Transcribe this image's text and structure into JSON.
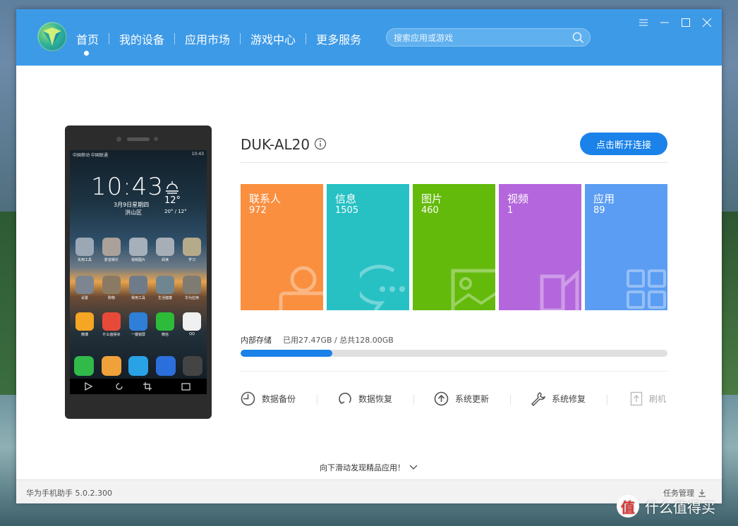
{
  "app": {
    "title": "华为手机助手",
    "version": "华为手机助手 5.0.2.300",
    "nav": [
      {
        "label": "首页",
        "active": true
      },
      {
        "label": "我的设备"
      },
      {
        "label": "应用市场"
      },
      {
        "label": "游戏中心"
      },
      {
        "label": "更多服务"
      }
    ],
    "search": {
      "placeholder": "搜索应用或游戏"
    },
    "colors": {
      "titlebar": "#3d9ae7",
      "accent": "#1a82e8"
    }
  },
  "device": {
    "name": "DUK-AL20",
    "disconnect_label": "点击断开连接",
    "phone_screen": {
      "status_left": "中国移动 中国联通",
      "status_right": "10:43",
      "time": "10:43",
      "date": "3月9日星期四",
      "location": "洪山区",
      "temperature": "12°",
      "temp_range": "20° / 12°",
      "row1": [
        "实用工具",
        "影音娱乐",
        "视频图片",
        "阅读",
        "学习"
      ],
      "row2": [
        "设置",
        "购物",
        "常用工具",
        "生活健康",
        "华为应用"
      ],
      "row3": [
        "微博",
        "什么值得买",
        "一键锁屏",
        "微信",
        "QQ"
      ]
    }
  },
  "tiles": [
    {
      "label": "联系人",
      "count": "972",
      "color": "#f98f3f",
      "icon": "person-icon"
    },
    {
      "label": "信息",
      "count": "1505",
      "color": "#27c1c4",
      "icon": "chat-icon"
    },
    {
      "label": "图片",
      "count": "460",
      "color": "#63ba0b",
      "icon": "image-icon"
    },
    {
      "label": "视频",
      "count": "1",
      "color": "#b467dc",
      "icon": "video-icon"
    },
    {
      "label": "应用",
      "count": "89",
      "color": "#5b9df2",
      "icon": "apps-icon"
    }
  ],
  "storage": {
    "label": "内部存储",
    "text": "已用27.47GB / 总共128.00GB",
    "used_fraction": 0.2146
  },
  "actions": [
    {
      "label": "数据备份",
      "icon": "backup-icon",
      "enabled": true
    },
    {
      "label": "数据恢复",
      "icon": "restore-icon",
      "enabled": true
    },
    {
      "label": "系统更新",
      "icon": "update-icon",
      "enabled": true
    },
    {
      "label": "系统修复",
      "icon": "wrench-icon",
      "enabled": true
    },
    {
      "label": "刷机",
      "icon": "flash-icon",
      "enabled": false
    }
  ],
  "scroll_hint": "向下滑动发现精品应用！",
  "footer": {
    "task_manager": "任务管理"
  },
  "watermark": {
    "text": "什么值得买",
    "badge": "值"
  }
}
